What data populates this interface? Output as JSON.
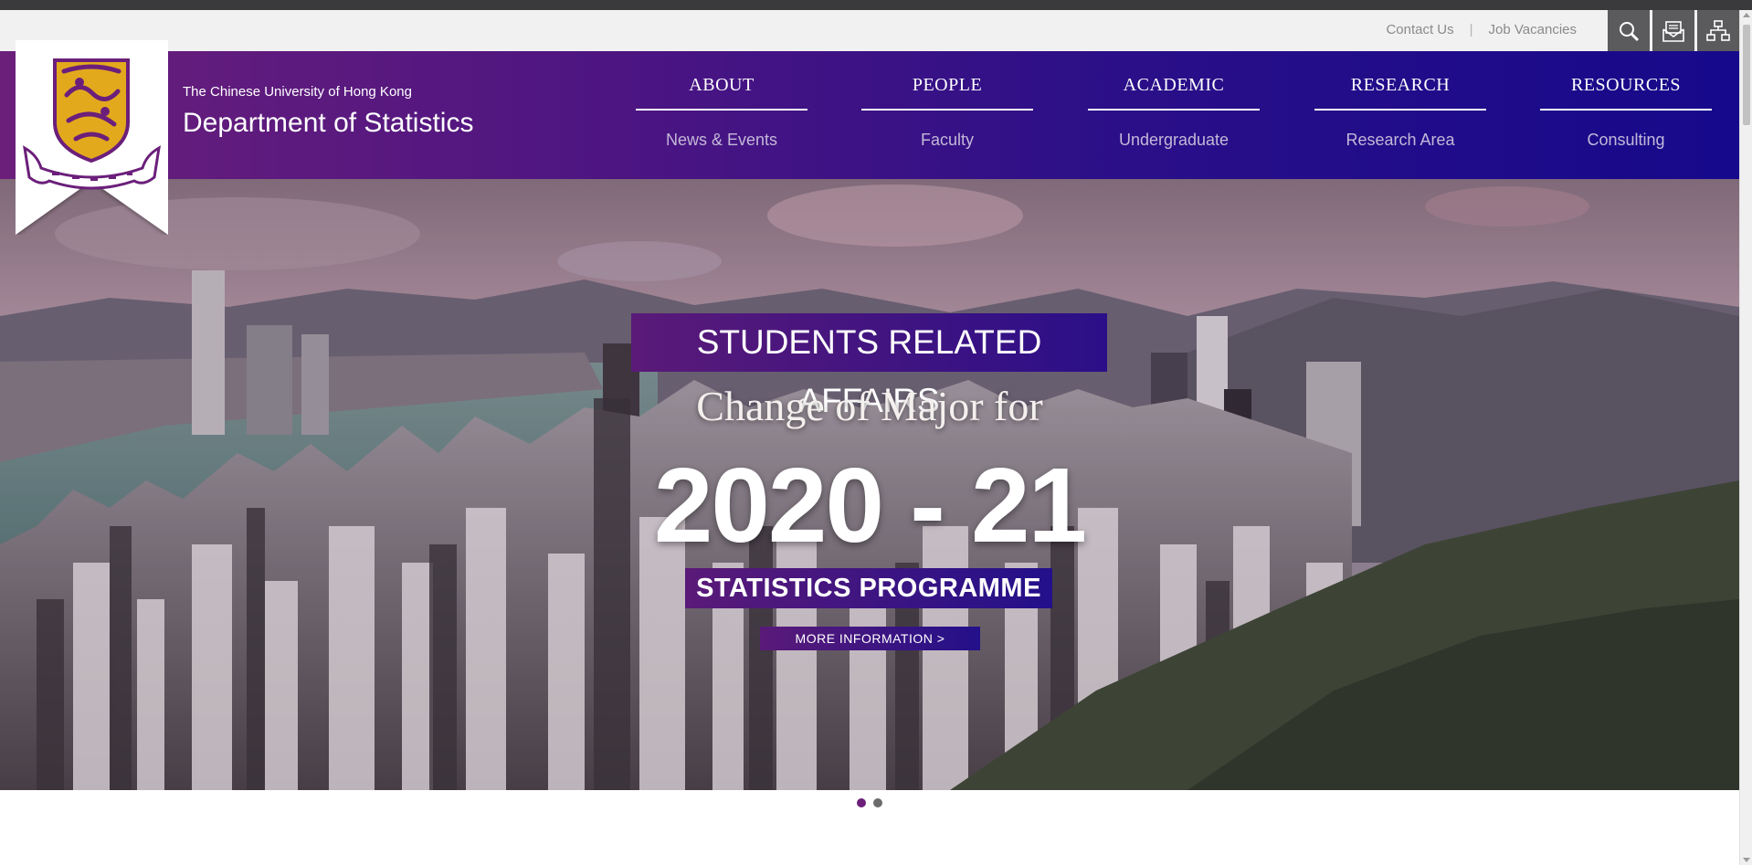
{
  "util": {
    "contact_us": "Contact Us",
    "separator": "|",
    "job_vacancies": "Job Vacancies",
    "icons": [
      "search-icon",
      "mail-icon",
      "sitemap-icon"
    ]
  },
  "header": {
    "university": "The Chinese University of Hong Kong",
    "department": "Department of Statistics"
  },
  "nav": [
    {
      "label": "ABOUT",
      "sub": "News & Events"
    },
    {
      "label": "PEOPLE",
      "sub": "Faculty"
    },
    {
      "label": "ACADEMIC",
      "sub": "Undergraduate"
    },
    {
      "label": "RESEARCH",
      "sub": "Research Area"
    },
    {
      "label": "RESOURCES",
      "sub": "Consulting"
    }
  ],
  "hero": {
    "tag": "STUDENTS RELATED AFFAIRS",
    "headline": "Change of Major for",
    "year": "2020 - 21",
    "programme": "STATISTICS  PROGRAMME",
    "button": "MORE  INFORMATION  >"
  },
  "slider": {
    "active_index": 0,
    "count": 2
  },
  "colors": {
    "brand_purple": "#6b1f7a",
    "brand_blue": "#16098b",
    "gold": "#e3a91d"
  }
}
